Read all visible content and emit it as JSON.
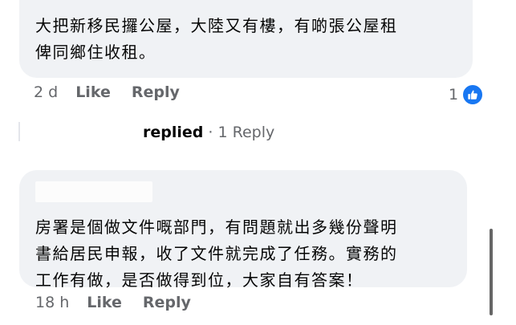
{
  "comment1": {
    "text_line1": "大把新移民攞公屋，大陸又有樓，有啲張公屋租",
    "text_line2": "俾同鄉住收租。",
    "time": "2 d",
    "like_label": "Like",
    "reply_label": "Reply",
    "reaction_count": "1",
    "reaction_icon": "thumbs-up-icon",
    "reaction_color": "#1877f2"
  },
  "replies": {
    "action": "replied",
    "separator": "·",
    "count_label": "1 Reply"
  },
  "comment2": {
    "text_line1": "房署是個做文件嘅部門，有問題就出多幾份聲明",
    "text_line2": "書給居民申報，收了文件就完成了任務。實務的",
    "text_line3": "工作有做，是否做得到位，大家自有答案！",
    "time": "18 h",
    "like_label": "Like",
    "reply_label": "Reply"
  }
}
